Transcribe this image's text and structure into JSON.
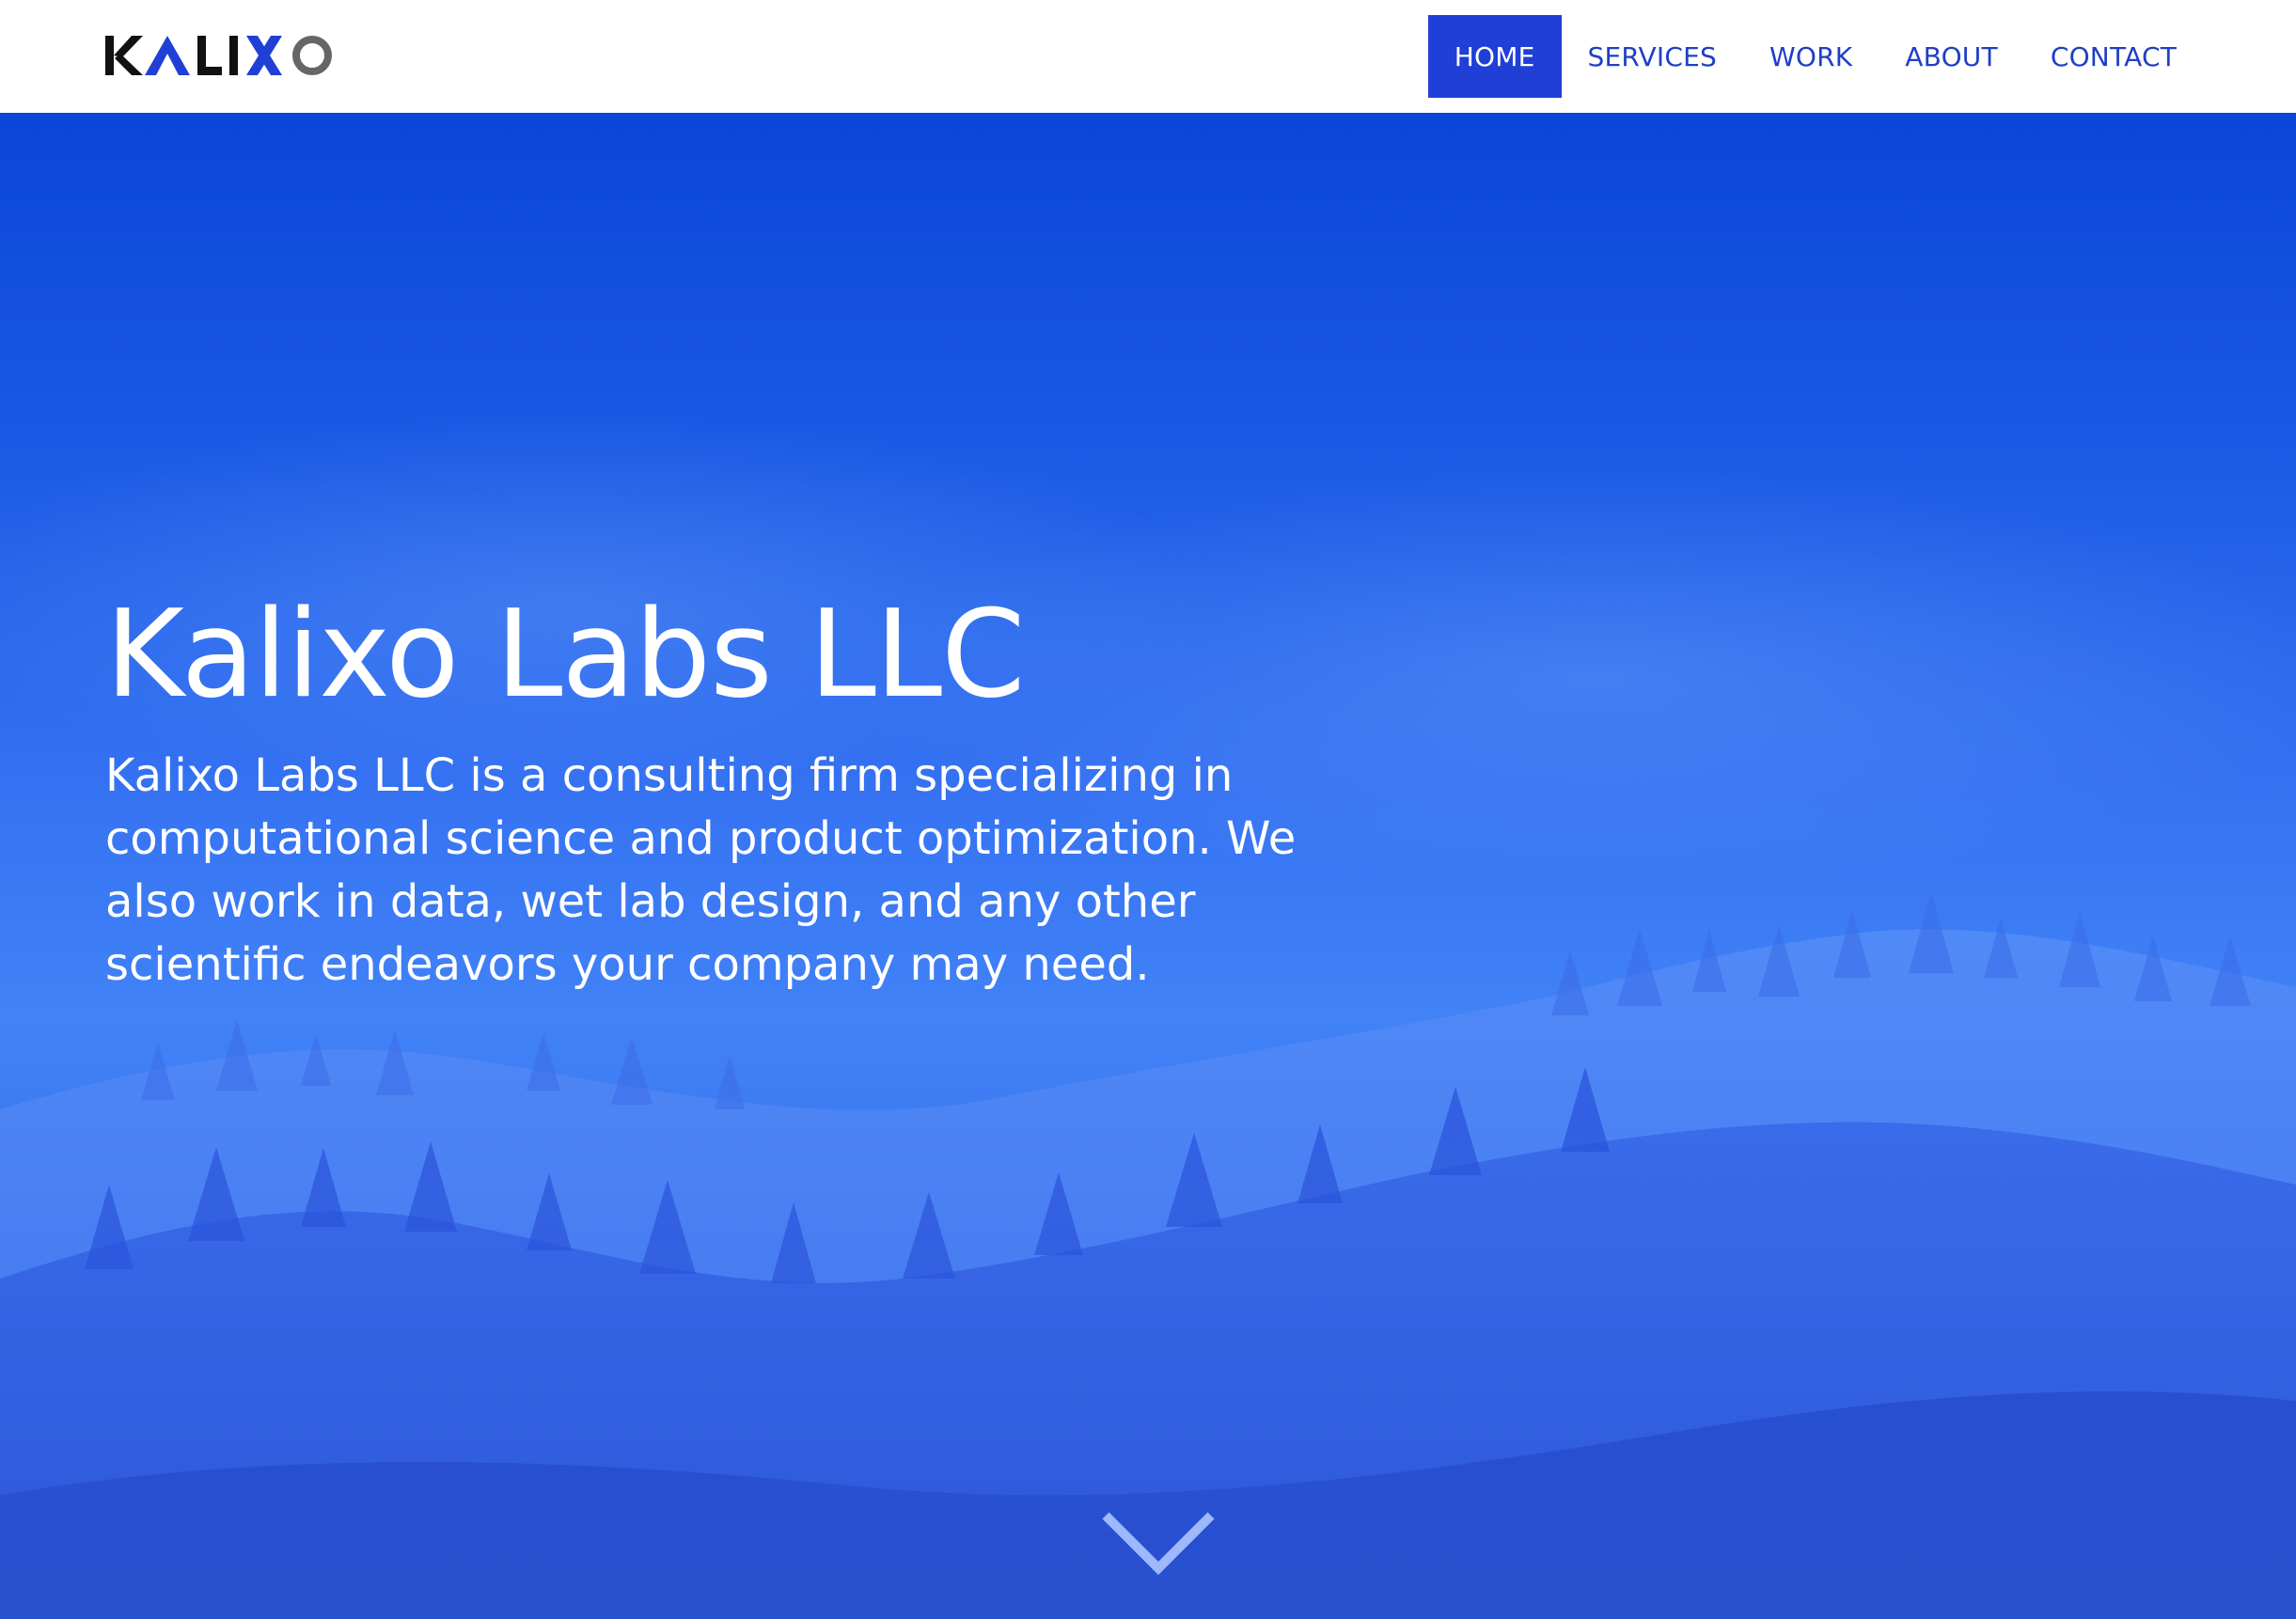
{
  "brand": {
    "logo_letters": [
      "K",
      "A",
      "L",
      "I",
      "X",
      "O"
    ],
    "colors": {
      "dark": "#111111",
      "accent": "#1f3fd6",
      "muted": "#666666"
    }
  },
  "nav": {
    "items": [
      {
        "label": "HOME",
        "active": true
      },
      {
        "label": "SERVICES",
        "active": false
      },
      {
        "label": "WORK",
        "active": false
      },
      {
        "label": "ABOUT",
        "active": false
      },
      {
        "label": "CONTACT",
        "active": false
      }
    ]
  },
  "hero": {
    "title": "Kalixo Labs LLC",
    "description": "Kalixo Labs LLC is a consulting firm specializing in computational science and product optimization. We also work in data, wet lab design, and any other scientific endeavors your company may need.",
    "scroll_icon": "chevron-down-icon",
    "background": "blue-tinted-forested-hills"
  },
  "colors": {
    "nav_text": "#1f3fc4",
    "nav_active_bg": "#1f3fd6",
    "hero_top": "#0a46d8",
    "hero_mid": "#357af6"
  }
}
